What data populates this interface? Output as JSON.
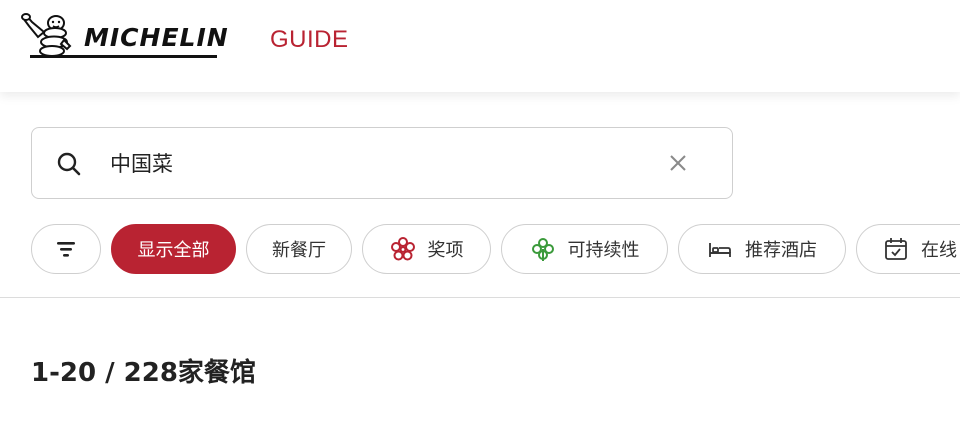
{
  "header": {
    "brand": "MICHELIN",
    "sub_brand": "GUIDE",
    "brand_color": "#b92332"
  },
  "search": {
    "value": "中国菜",
    "icon": "search-icon",
    "clear_icon": "close-icon"
  },
  "filters": {
    "filter_icon": "filter-icon",
    "chips": [
      {
        "label": "显示全部",
        "active": true
      },
      {
        "label": "新餐厅",
        "active": false
      },
      {
        "label": "奖项",
        "icon": "michelin-star-icon",
        "icon_color": "#b92332"
      },
      {
        "label": "可持续性",
        "icon": "green-clover-icon",
        "icon_color": "#3a9a3a"
      },
      {
        "label": "推荐酒店",
        "icon": "bed-icon"
      },
      {
        "label": "在线",
        "icon": "calendar-check-icon"
      }
    ]
  },
  "results": {
    "summary": "1-20 / 228家餐馆"
  }
}
